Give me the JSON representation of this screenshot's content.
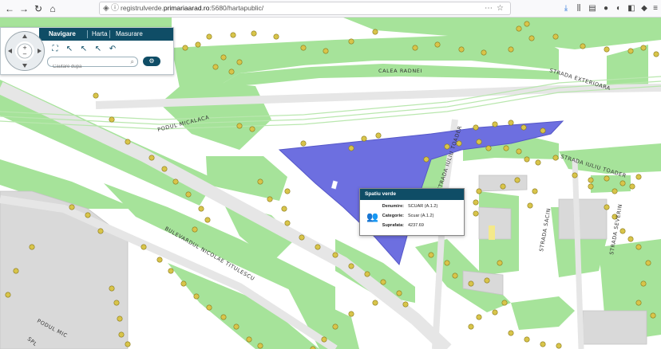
{
  "browser": {
    "url_prefix": "registrulverde.",
    "url_domain": "primariaarad.ro",
    "url_suffix": ":5680/hartapublic/",
    "icons": {
      "back": "back-arrow-icon",
      "forward": "forward-arrow-icon",
      "reload": "reload-icon",
      "home": "home-icon"
    }
  },
  "nav_panel": {
    "tabs": [
      "Navigare",
      "Harta",
      "Masurare"
    ],
    "active_tab": "Navigare",
    "search_placeholder": "Cautare dupa",
    "accent_color": "#0f4d66"
  },
  "map": {
    "streets": {
      "calea_radnei": "CALEA RADNEI",
      "strada_exterioara": "STRADA EXTERIOARA",
      "podul_micalaca": "PODUL MICALACA",
      "strada_iuliu_toader_upper": "STRADA IULIU TOADER",
      "strada_iuliu_toader_vertical": "STRADA IULIU TOADER",
      "strada_sacin": "STRADA SACIN",
      "strada_severin": "STRADA SEVERIN",
      "bulevardul": "BULEVARDUL NICOLAE TITULESCU",
      "podul_mic": "PODUL MIC",
      "splaiul": "SPL"
    },
    "colors": {
      "green_space": "#a6e39a",
      "selected_polygon": "#6d6fe0",
      "road": "#f2f2f2",
      "building": "#d9d9d9",
      "tree": "#c9b23c"
    }
  },
  "popup": {
    "title": "Spatiu verde",
    "icon": "people-icon",
    "rows": [
      {
        "label": "Denumire:",
        "value": "SCUAR (A.1.2)"
      },
      {
        "label": "Categorie:",
        "value": "Scuar (A.1.2)"
      },
      {
        "label": "Suprafata:",
        "value": "4237.69"
      }
    ]
  }
}
